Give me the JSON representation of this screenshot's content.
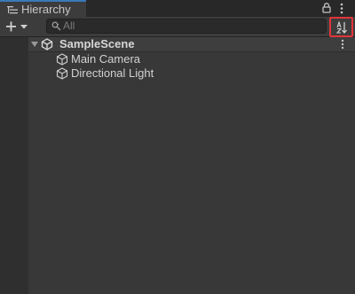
{
  "window": {
    "tab_label": "Hierarchy",
    "tab_icon": "hierarchy-list-icon",
    "lock_icon": "lock-icon",
    "menu_icon": "kebab-menu-icon"
  },
  "toolbar": {
    "create_icon": "plus-dropdown-icon",
    "search_icon": "search-icon",
    "search_placeholder": "All",
    "sort_icon": "sort-alphabetical-icon"
  },
  "tree": {
    "scene": {
      "label": "SampleScene",
      "icon": "unity-logo-icon",
      "expanded": true,
      "menu_icon": "kebab-menu-icon"
    },
    "items": [
      {
        "label": "Main Camera",
        "icon": "gameobject-cube-icon"
      },
      {
        "label": "Directional Light",
        "icon": "gameobject-cube-icon"
      }
    ]
  },
  "colors": {
    "background": "#383838",
    "tab_accent": "#3a79bb",
    "highlight_border": "#e0353a"
  }
}
